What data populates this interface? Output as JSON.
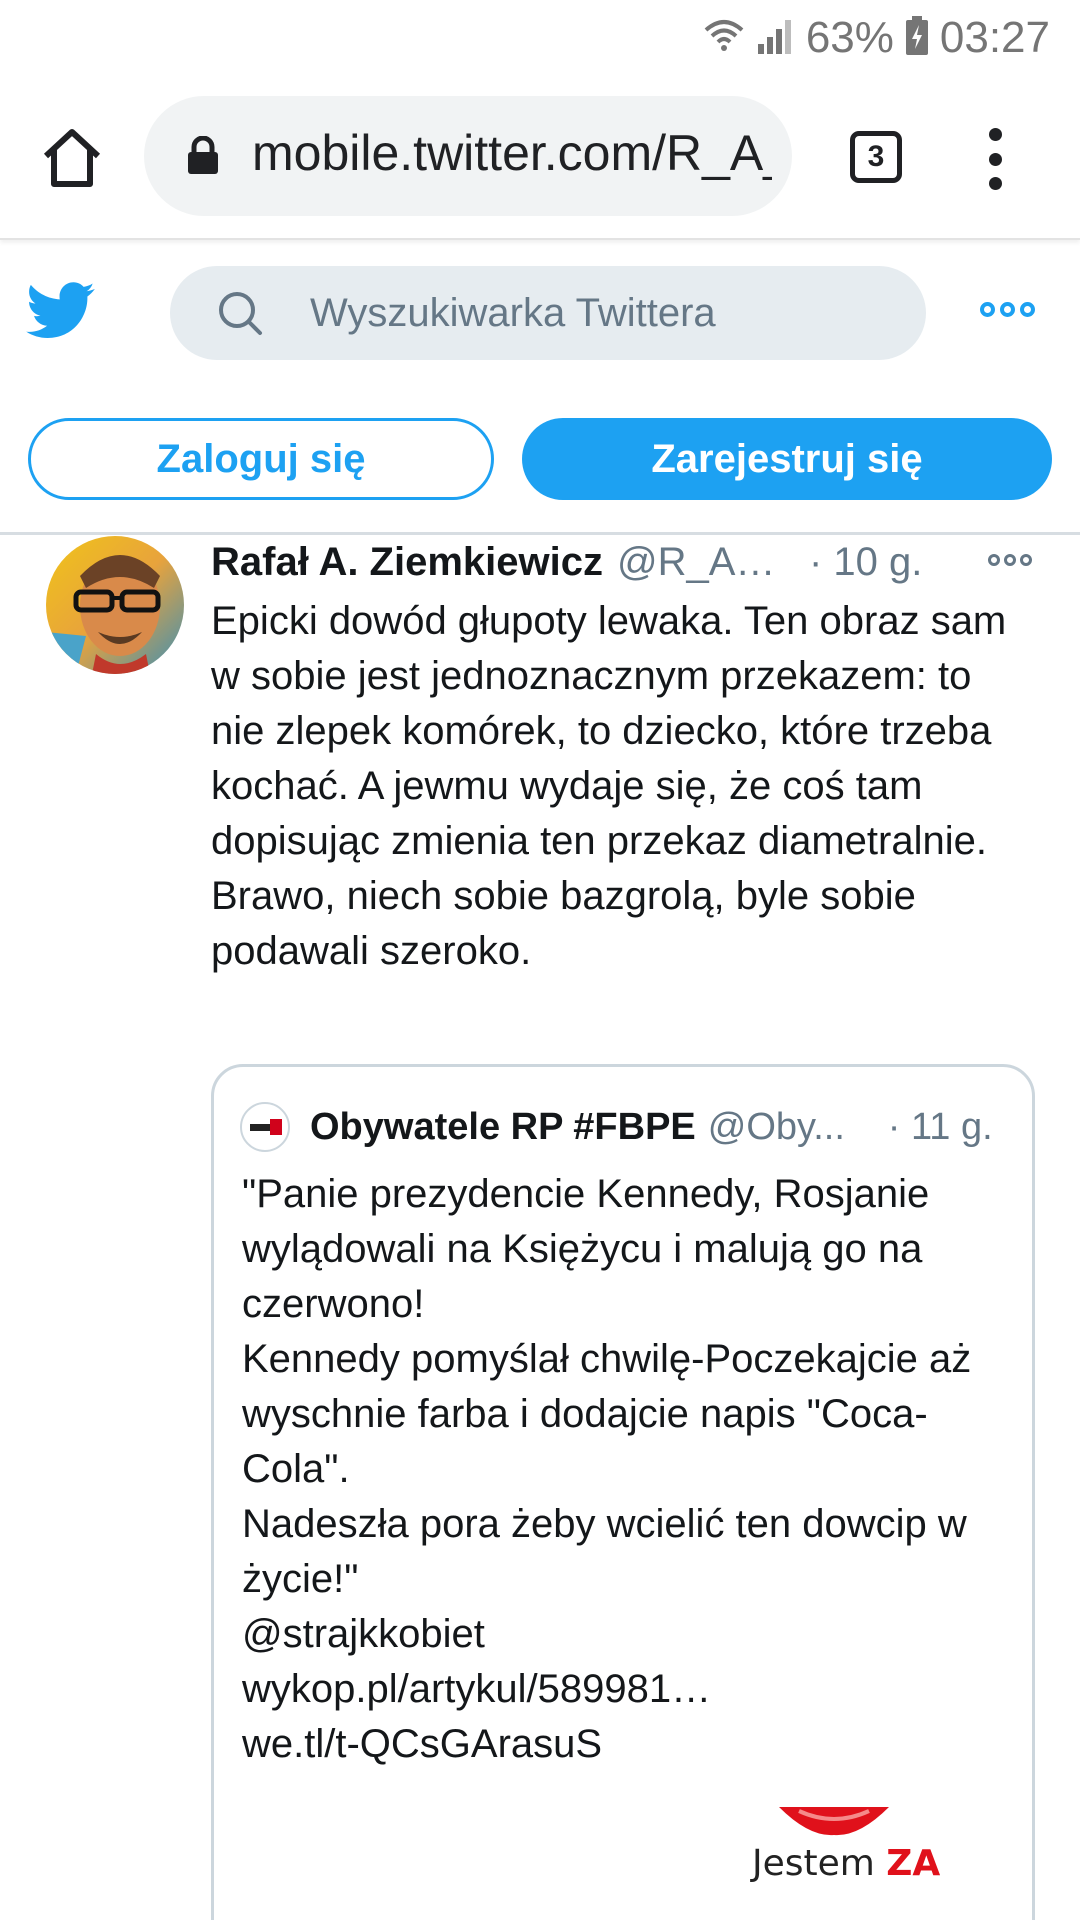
{
  "status_bar": {
    "battery": "63%",
    "time": "03:27"
  },
  "browser": {
    "url": "mobile.twitter.com/R_A_Ziemkiewicz",
    "tab_count": "3"
  },
  "twitter_header": {
    "search_placeholder": "Wyszukiwarka Twittera"
  },
  "auth": {
    "login_label": "Zaloguj się",
    "signup_label": "Zarejestruj się"
  },
  "tweet": {
    "author_name": "Rafał A. Ziemkiewicz",
    "author_handle": "@R_A_...",
    "time": "· 10 g.",
    "text": "Epicki dowód głupoty lewaka. Ten obraz sam w sobie jest jednoznacznym przekazem: to nie zlepek komórek, to dziecko, które trzeba kochać. A jewmu wydaje się, że coś tam dopisując zmienia ten przekaz diametralnie. Brawo, niech sobie bazgrolą, byle sobie podawali szeroko."
  },
  "quoted_tweet": {
    "author_name": "Obywatele RP #FBPE",
    "author_handle": "@Oby...",
    "time": "· 11 g.",
    "text": "\"Panie prezydencie Kennedy, Rosjanie wylądowali na Księżycu i malują go na czerwono!\nKennedy pomyślał chwilę-Poczekajcie aż wyschnie farba i dodajcie napis \"Coca-Cola\".\nNadeszła pora żeby wcielić ten dowcip w życie!\"\n@strajkkobiet\nwykop.pl/artykul/589981…\nwe.tl/t-QCsGArasuS",
    "image_text_prefix": "Jestem ",
    "image_text_accent": "ZA"
  },
  "colors": {
    "twitter_blue": "#1da1f2",
    "secondary_text": "#657786",
    "border": "#ccd6dd",
    "search_bg": "#e6ecf0",
    "accent_red": "#e0111b"
  },
  "icons": [
    "wifi-icon",
    "signal-icon",
    "battery-icon",
    "home-icon",
    "lock-icon",
    "tabs-icon",
    "kebab-menu-icon",
    "twitter-bird-icon",
    "search-icon",
    "more-icon"
  ]
}
